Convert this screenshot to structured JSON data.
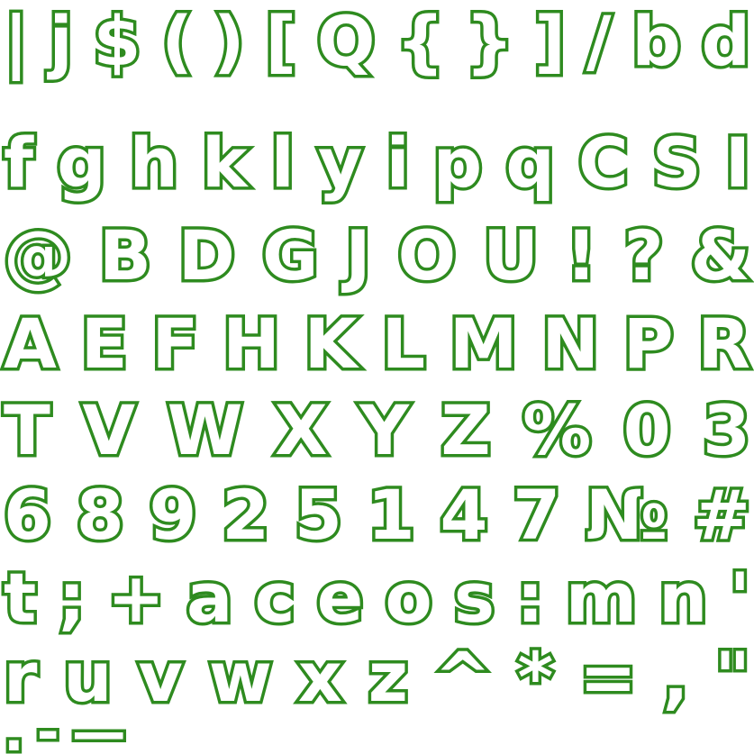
{
  "glyph_sheet": {
    "stroke_color": "#2e8b1f",
    "fill_color": "#ffffff",
    "background_color": "#ffffff",
    "rows": [
      {
        "glyphs": [
          "|",
          "j",
          "$",
          "(",
          ")",
          "[",
          "Q",
          "{",
          "}",
          "]",
          "/",
          "b",
          "d"
        ]
      },
      {
        "glyphs": [
          "f",
          "g",
          "h",
          "k",
          "l",
          "y",
          "i",
          "p",
          "q",
          "C",
          "S",
          "I"
        ]
      },
      {
        "glyphs": [
          "@",
          "B",
          "D",
          "G",
          "J",
          "O",
          "U",
          "!",
          "?",
          "&"
        ]
      },
      {
        "glyphs": [
          "A",
          "E",
          "F",
          "H",
          "K",
          "L",
          "M",
          "N",
          "P",
          "R"
        ]
      },
      {
        "glyphs": [
          "T",
          "V",
          "W",
          "X",
          "Y",
          "Z",
          "%",
          "0",
          "3"
        ]
      },
      {
        "glyphs": [
          "6",
          "8",
          "9",
          "2",
          "5",
          "1",
          "4",
          "7",
          "№",
          "#"
        ]
      },
      {
        "glyphs": [
          "t",
          ";",
          "+",
          "a",
          "c",
          "e",
          "o",
          "s",
          ":",
          "m",
          "n",
          "'"
        ]
      },
      {
        "glyphs": [
          "r",
          "u",
          "v",
          "w",
          "x",
          "z",
          "^",
          "*",
          "=",
          ",",
          "\""
        ]
      },
      {
        "glyphs": [
          ".",
          "-",
          "—"
        ]
      }
    ]
  }
}
